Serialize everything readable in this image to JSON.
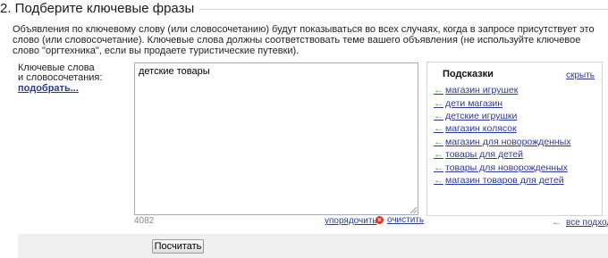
{
  "section": {
    "title": "2. Подберите ключевые фразы",
    "description": "Объявления по ключевому слову (или словосочетанию) будут показываться во всех случаях, когда в запросе присутствует это слово (или словосочетание). Ключевые слова должны соответствовать теме вашего объявления (не используйте ключевое слово \"оргтехника\", если вы продаете туристические путевки)."
  },
  "keywords": {
    "label_line1": "Ключевые слова",
    "label_line2": "и словосочетания:",
    "pick_link": "подобрать...",
    "value": "детские товары",
    "remaining_count": "4082",
    "sort_link": "упорядочить",
    "clear_link": "очистить"
  },
  "hints": {
    "title": "Подсказки",
    "hide_link": "скрыть",
    "items": [
      "магазин игрушек",
      "дети магазин",
      "детские игрушки",
      "магазин колясок",
      "магазин для новорожденных",
      "товары для детей",
      "товары для новорожденных",
      "магазин товаров для детей"
    ],
    "all_fit_link": "все подходят"
  },
  "actions": {
    "calculate_button": "Посчитать"
  },
  "colors": {
    "link": "#2a3a9c",
    "arrow": "#4aa33a",
    "clear_icon": "#d9352c",
    "bottom_bar": "#f0f0f0"
  },
  "icons": {
    "hint_arrow": "arrow-left-icon",
    "clear": "clear-icon",
    "resize": "resize-grip-icon"
  }
}
